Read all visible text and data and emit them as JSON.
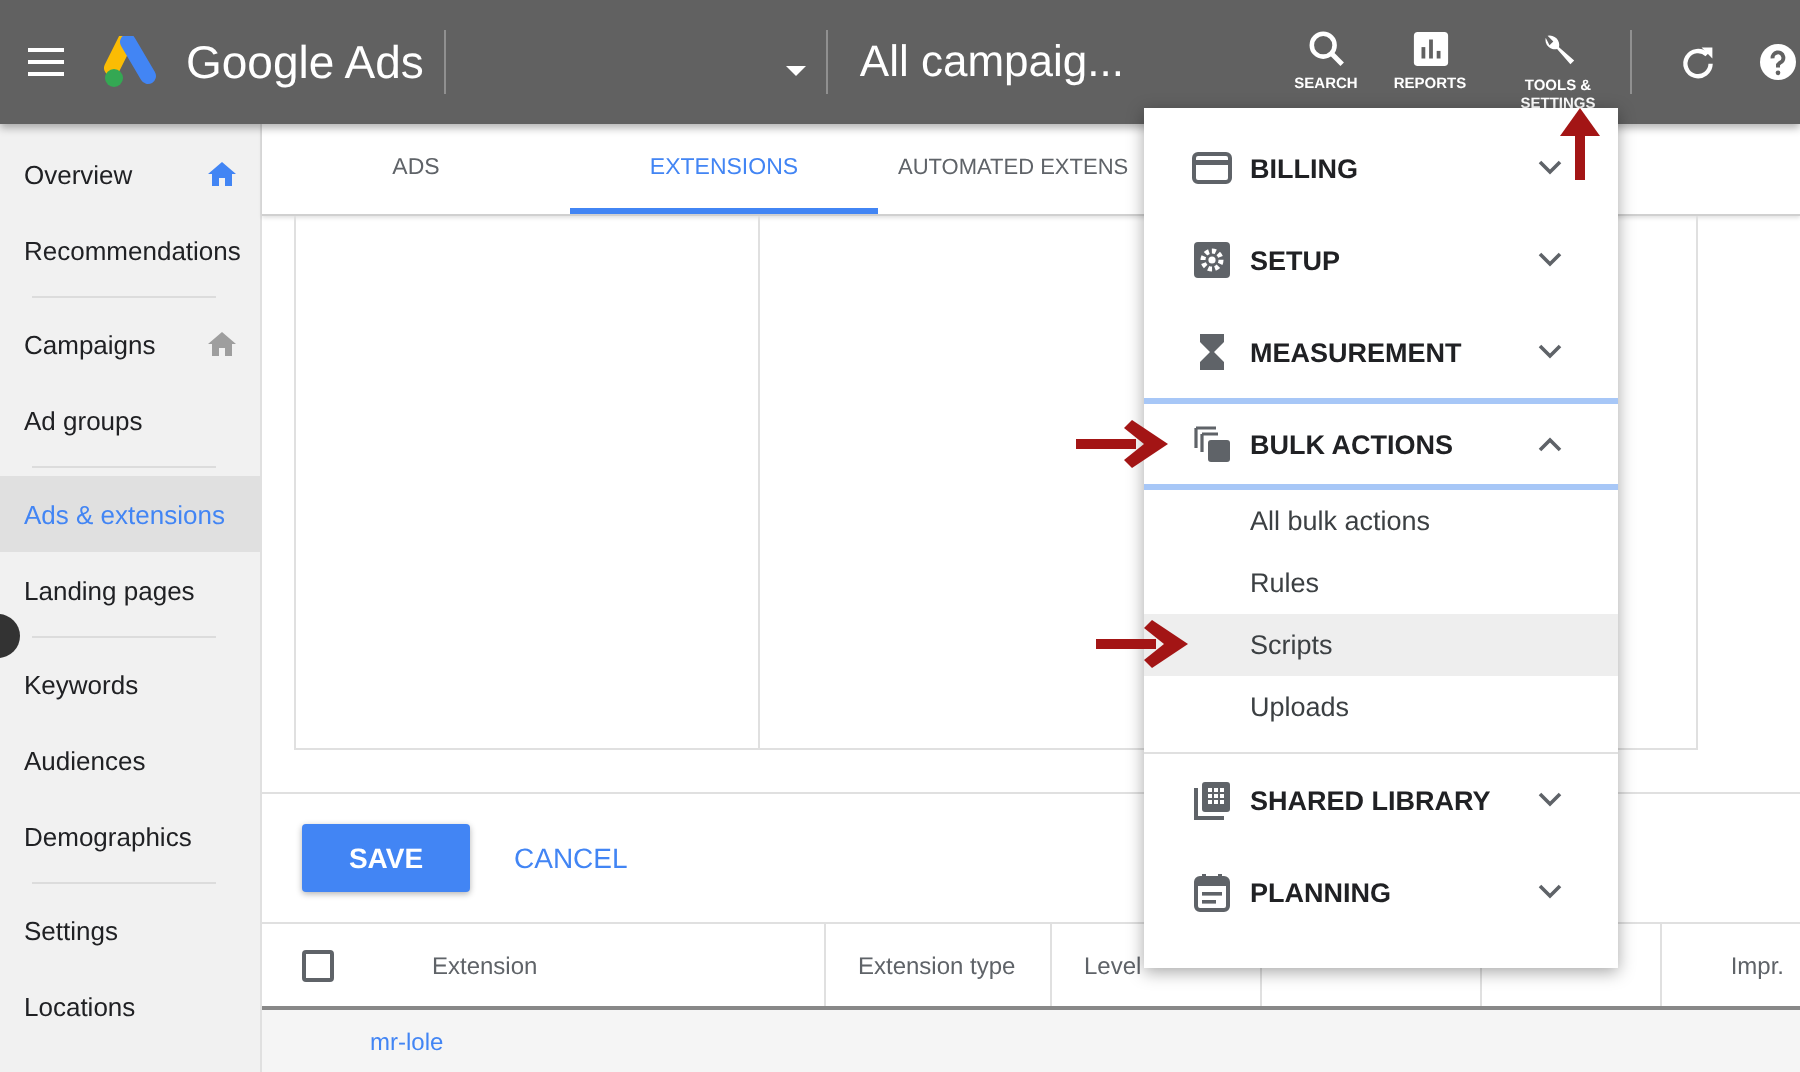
{
  "header": {
    "app_name": "Google Ads",
    "account_title": "All campaig...",
    "actions": [
      {
        "kind": "search",
        "label": "SEARCH"
      },
      {
        "kind": "reports",
        "label": "REPORTS"
      },
      {
        "kind": "tools",
        "label": "TOOLS & SETTINGS"
      }
    ]
  },
  "sidebar": {
    "items": [
      {
        "label": "Overview",
        "selected": false,
        "home_icon": true,
        "home_active": true,
        "divider_after": false
      },
      {
        "label": "Recommendations",
        "selected": false,
        "divider_after": true
      },
      {
        "label": "Campaigns",
        "selected": false,
        "home_icon": true,
        "home_active": false,
        "divider_after": false
      },
      {
        "label": "Ad groups",
        "selected": false,
        "divider_after": true
      },
      {
        "label": "Ads & extensions",
        "selected": true,
        "divider_after": false
      },
      {
        "label": "Landing pages",
        "selected": false,
        "divider_after": true
      },
      {
        "label": "Keywords",
        "selected": false,
        "divider_after": false
      },
      {
        "label": "Audiences",
        "selected": false,
        "divider_after": false
      },
      {
        "label": "Demographics",
        "selected": false,
        "divider_after": true
      },
      {
        "label": "Settings",
        "selected": false,
        "divider_after": false
      },
      {
        "label": "Locations",
        "selected": false,
        "divider_after": false
      }
    ]
  },
  "tabs": [
    {
      "label": "ADS",
      "selected": false
    },
    {
      "label": "EXTENSIONS",
      "selected": true
    },
    {
      "label": "AUTOMATED EXTENS",
      "selected": false
    }
  ],
  "buttons": {
    "save": "SAVE",
    "cancel": "CANCEL"
  },
  "table": {
    "select_all_checked": false,
    "columns": [
      "Extension",
      "Extension type",
      "Level",
      "Impr."
    ],
    "rows": [
      {
        "extension": "mr-lole"
      }
    ]
  },
  "menu": {
    "sections": [
      {
        "kind": "billing",
        "label": "BILLING",
        "expanded": false
      },
      {
        "kind": "setup",
        "label": "SETUP",
        "expanded": false
      },
      {
        "kind": "measurement",
        "label": "MEASUREMENT",
        "expanded": false
      },
      {
        "kind": "bulk",
        "label": "BULK ACTIONS",
        "expanded": true,
        "children": [
          {
            "label": "All bulk actions",
            "selected": false
          },
          {
            "label": "Rules",
            "selected": false
          },
          {
            "label": "Scripts",
            "selected": true
          },
          {
            "label": "Uploads",
            "selected": false
          }
        ]
      },
      {
        "kind": "library",
        "label": "SHARED LIBRARY",
        "expanded": false
      },
      {
        "kind": "planning",
        "label": "PLANNING",
        "expanded": false
      }
    ]
  }
}
